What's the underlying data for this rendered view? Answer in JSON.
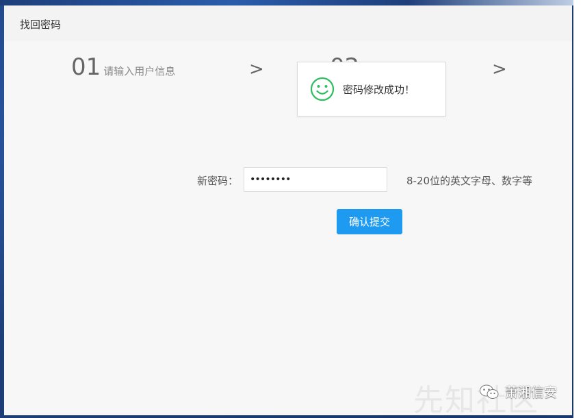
{
  "dialog": {
    "title": "找回密码"
  },
  "steps": [
    {
      "num": "01",
      "label": "请输入用户信息"
    },
    {
      "num": "02",
      "label": ""
    }
  ],
  "separator": ">",
  "toast": {
    "message": "密码修改成功！",
    "icon": "smile-icon",
    "color": "#2dbe60"
  },
  "form": {
    "password_label": "新密码：",
    "password_value": "••••••••",
    "password_hint": "8-20位的英文字母、数字等",
    "submit_label": "确认提交"
  },
  "watermark": {
    "text": "萧湘信安",
    "icon": "wechat-icon",
    "ghost_text": "先知社区"
  },
  "colors": {
    "accent": "#1e9bf0",
    "toast_icon": "#2dbe60",
    "frame": "#1c3d75"
  }
}
